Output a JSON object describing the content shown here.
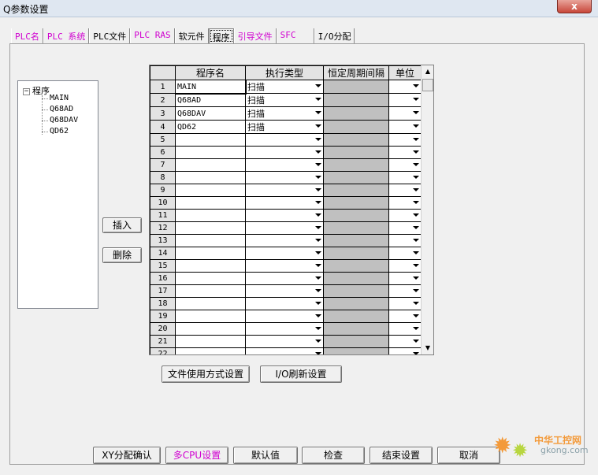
{
  "window": {
    "title": "Q参数设置",
    "close": "x"
  },
  "tabs": [
    {
      "label": "PLC名"
    },
    {
      "label": "PLC 系统"
    },
    {
      "label": "PLC文件"
    },
    {
      "label": "PLC RAS"
    },
    {
      "label": "软元件"
    },
    {
      "label": "程序"
    },
    {
      "label": "引导文件"
    },
    {
      "label": "SFC"
    },
    {
      "label": "I/O分配"
    }
  ],
  "tree": {
    "root": "程序",
    "toggle": "−",
    "items": [
      "MAIN",
      "Q68AD",
      "Q68DAV",
      "QD62"
    ]
  },
  "side_buttons": {
    "insert": "插入",
    "delete": "删除"
  },
  "grid": {
    "headers": [
      "程序名",
      "执行类型",
      "恒定周期间隔",
      "单位"
    ],
    "rows": [
      {
        "num": "1",
        "name": "MAIN",
        "type": "扫描"
      },
      {
        "num": "2",
        "name": "Q68AD",
        "type": "扫描"
      },
      {
        "num": "3",
        "name": "Q68DAV",
        "type": "扫描"
      },
      {
        "num": "4",
        "name": "QD62",
        "type": "扫描"
      },
      {
        "num": "5",
        "name": "",
        "type": ""
      },
      {
        "num": "6",
        "name": "",
        "type": ""
      },
      {
        "num": "7",
        "name": "",
        "type": ""
      },
      {
        "num": "8",
        "name": "",
        "type": ""
      },
      {
        "num": "9",
        "name": "",
        "type": ""
      },
      {
        "num": "10",
        "name": "",
        "type": ""
      },
      {
        "num": "11",
        "name": "",
        "type": ""
      },
      {
        "num": "12",
        "name": "",
        "type": ""
      },
      {
        "num": "13",
        "name": "",
        "type": ""
      },
      {
        "num": "14",
        "name": "",
        "type": ""
      },
      {
        "num": "15",
        "name": "",
        "type": ""
      },
      {
        "num": "16",
        "name": "",
        "type": ""
      },
      {
        "num": "17",
        "name": "",
        "type": ""
      },
      {
        "num": "18",
        "name": "",
        "type": ""
      },
      {
        "num": "19",
        "name": "",
        "type": ""
      },
      {
        "num": "20",
        "name": "",
        "type": ""
      },
      {
        "num": "21",
        "name": "",
        "type": ""
      },
      {
        "num": "22",
        "name": "",
        "type": ""
      }
    ]
  },
  "mid_buttons": {
    "file_usage": "文件使用方式设置",
    "io_refresh": "I/O刷新设置"
  },
  "bottom_buttons": {
    "xy_confirm": "XY分配确认",
    "multi_cpu": "多CPU设置",
    "default": "默认值",
    "check": "检查",
    "end": "结束设置",
    "cancel": "取消"
  },
  "watermark": {
    "brand": "中华工控网",
    "url": "gkong.com"
  },
  "colors": {
    "tab_accent": "#d000d0",
    "grid_disabled": "#c0c0c0"
  }
}
